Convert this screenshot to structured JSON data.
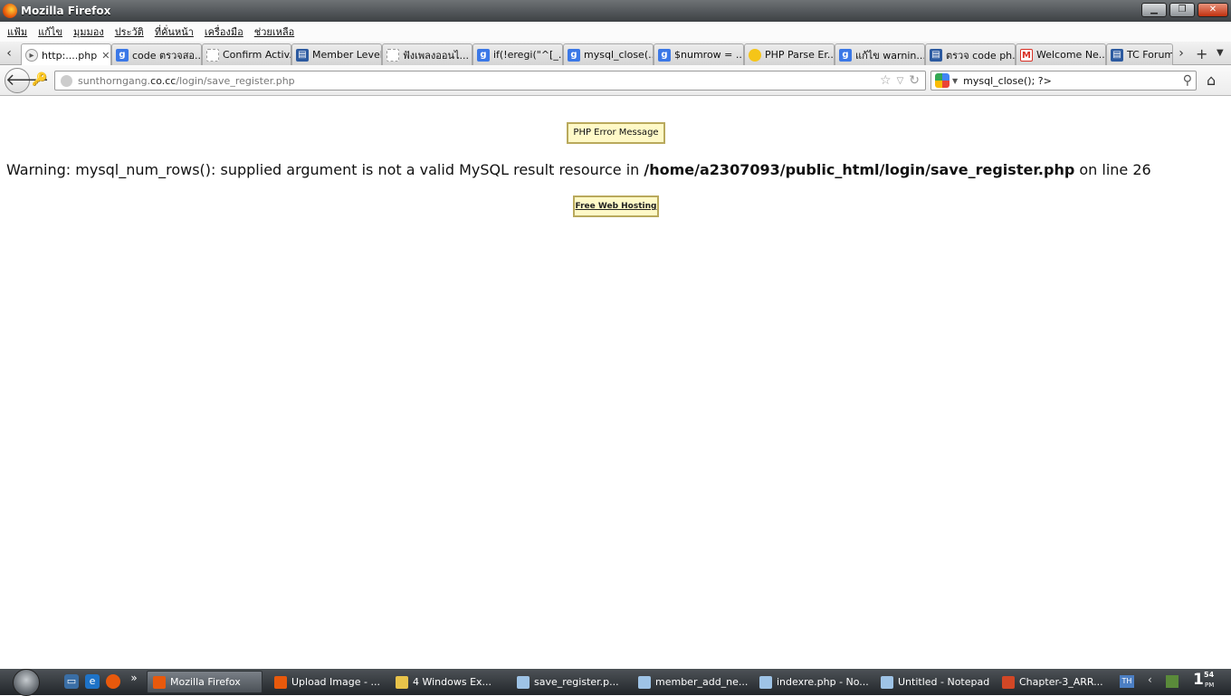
{
  "window": {
    "title": "Mozilla Firefox",
    "min": "▁",
    "max": "❐",
    "close": "✕"
  },
  "menu": [
    "แฟ้ม",
    "แก้ไข",
    "มุมมอง",
    "ประวัติ",
    "ที่คั่นหน้า",
    "เครื่องมือ",
    "ช่วยเหลือ"
  ],
  "tabs": [
    {
      "label": "http:....php",
      "icon": "globe",
      "active": true
    },
    {
      "label": "code ตรวจสอ...",
      "icon": "g"
    },
    {
      "label": "Confirm Activ...",
      "icon": "blank"
    },
    {
      "label": "Member Level",
      "icon": "doc"
    },
    {
      "label": "ฟังเพลงออนไ...",
      "icon": "blank"
    },
    {
      "label": "if(!eregi(\"^[_...",
      "icon": "g"
    },
    {
      "label": "mysql_close(...",
      "icon": "g"
    },
    {
      "label": "$numrow = ...",
      "icon": "g"
    },
    {
      "label": "PHP Parse Er...",
      "icon": "bulb"
    },
    {
      "label": "แก้ไข warnin...",
      "icon": "g"
    },
    {
      "label": "ตรวจ code ph...",
      "icon": "doc"
    },
    {
      "label": "Welcome Ne...",
      "icon": "gmail"
    },
    {
      "label": "TC Forum",
      "icon": "doc"
    }
  ],
  "nav": {
    "url_prefix": "sunthorngang.",
    "url_domain": "co.cc",
    "url_path": "/login/save_register.php",
    "search_value": "mysql_close(); ?>"
  },
  "page": {
    "error_box": "PHP Error Message",
    "warning_label": "Warning",
    "warning_text": ": mysql_num_rows(): supplied argument is not a valid MySQL result resource in ",
    "warning_path": "/home/a2307093/public_html/login/save_register.php",
    "warning_on_line": " on line ",
    "warning_line": "26",
    "hosting_link": "Free Web Hosting"
  },
  "taskbar": {
    "buttons": [
      {
        "label": "Mozilla Firefox",
        "active": true,
        "color": "#e8590c"
      },
      {
        "label": "Upload Image - ...",
        "color": "#e8590c"
      },
      {
        "label": "4 Windows Ex...",
        "color": "#e8c34a"
      },
      {
        "label": "save_register.p...",
        "color": "#9ec3e6"
      },
      {
        "label": "member_add_ne...",
        "color": "#9ec3e6"
      },
      {
        "label": "indexre.php - No...",
        "color": "#9ec3e6"
      },
      {
        "label": "Untitled - Notepad",
        "color": "#9ec3e6"
      },
      {
        "label": "Chapter-3_ARR...",
        "color": "#d24726"
      }
    ],
    "lang": "TH",
    "clock_hour": "1",
    "clock_min": "54",
    "clock_ampm": "PM"
  }
}
